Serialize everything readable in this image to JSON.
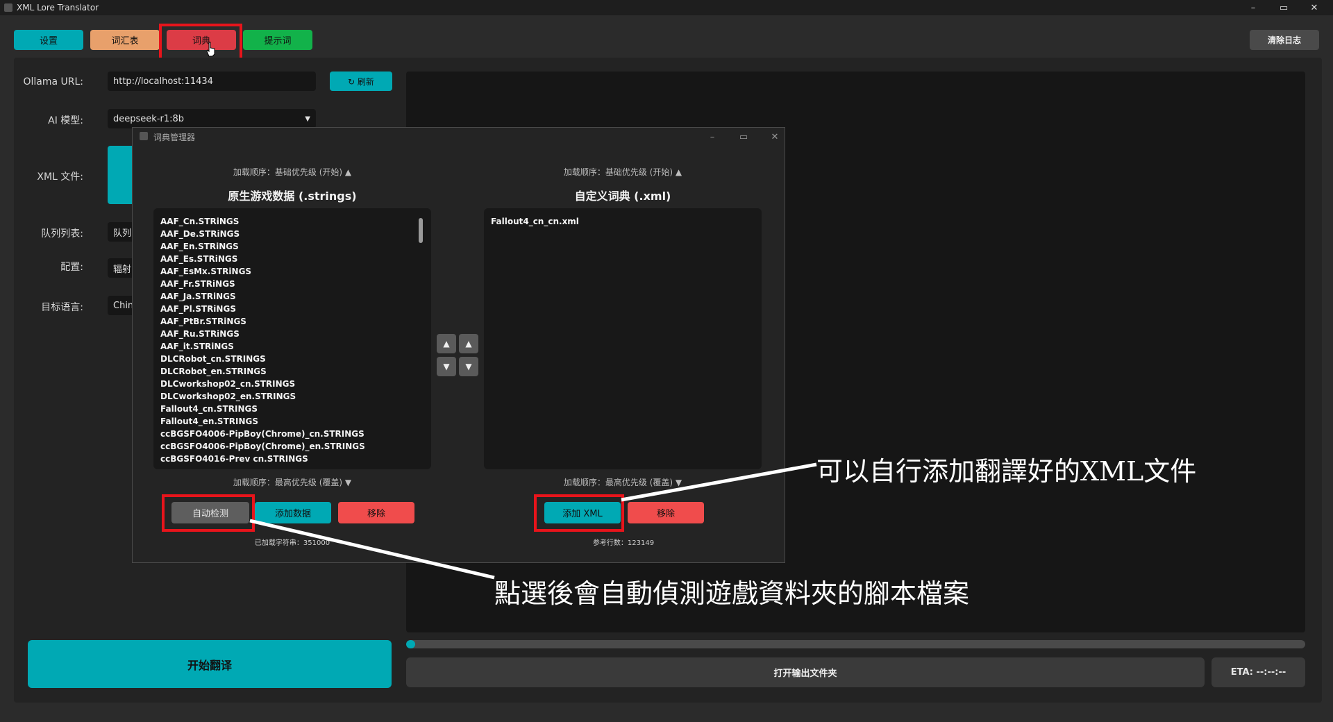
{
  "window": {
    "title": "XML Lore Translator",
    "controls": [
      "–",
      "▭",
      "✕"
    ]
  },
  "toolbar": {
    "settings": "设置",
    "glossary": "词汇表",
    "dictionary": "词典",
    "prompt": "提示词",
    "clear_log": "清除日志"
  },
  "form": {
    "ollama_label": "Ollama URL:",
    "ollama_value": "http://localhost:11434",
    "refresh": "↻ 刷新",
    "model_label": "AI 模型:",
    "model_value": "deepseek-r1:8b",
    "xml_label": "XML 文件:",
    "queue_label": "队列列表:",
    "queue_value": "队列",
    "config_label": "配置:",
    "config_value": "辐射",
    "target_label": "目标语言:",
    "target_value": "Chine"
  },
  "bottom": {
    "start": "开始翻译",
    "open_output": "打开输出文件夹",
    "eta": "ETA: --:--:--",
    "progress": 0.01
  },
  "dialog": {
    "title": "词典管理器",
    "left": {
      "order_top": "加载顺序：基础优先级 (开始) ▲",
      "title": "原生游戏数据 (.strings)",
      "items": [
        "AAF_Cn.STRiNGS",
        "AAF_De.STRiNGS",
        "AAF_En.STRiNGS",
        "AAF_Es.STRiNGS",
        "AAF_EsMx.STRiNGS",
        "AAF_Fr.STRiNGS",
        "AAF_Ja.STRiNGS",
        "AAF_Pl.STRiNGS",
        "AAF_PtBr.STRiNGS",
        "AAF_Ru.STRiNGS",
        "AAF_it.STRiNGS",
        "DLCRobot_cn.STRINGS",
        "DLCRobot_en.STRINGS",
        "DLCworkshop02_cn.STRINGS",
        "DLCworkshop02_en.STRINGS",
        "Fallout4_cn.STRINGS",
        "Fallout4_en.STRINGS",
        "ccBGSFO4006-PipBoy(Chrome)_cn.STRINGS",
        "ccBGSFO4006-PipBoy(Chrome)_en.STRINGS",
        "ccBGSFO4016-Prev cn.STRINGS"
      ],
      "order_bottom": "加载顺序：最高优先级 (覆盖) ▼",
      "auto_detect": "自动检测",
      "add_data": "添加数据",
      "remove": "移除",
      "count": "已加载字符串：351000"
    },
    "arrows": [
      "▲",
      "▲",
      "▼",
      "▼"
    ],
    "right": {
      "order_top": "加载顺序：基础优先级 (开始) ▲",
      "title": "自定义词典 (.xml)",
      "items": [
        "Fallout4_cn_cn.xml"
      ],
      "order_bottom": "加载顺序：最高优先级 (覆盖) ▼",
      "add_xml": "添加 XML",
      "remove": "移除",
      "count": "参考行数：123149"
    }
  },
  "annotations": {
    "xml_note": "可以自行添加翻譯好的XML文件",
    "detect_note": "點選後會自動偵測遊戲資料夾的腳本檔案"
  },
  "colors": {
    "teal": "#00a9b4",
    "orange": "#e8a06b",
    "red": "#dc3c46",
    "green": "#12b24a",
    "highlight": "#e8141b"
  }
}
